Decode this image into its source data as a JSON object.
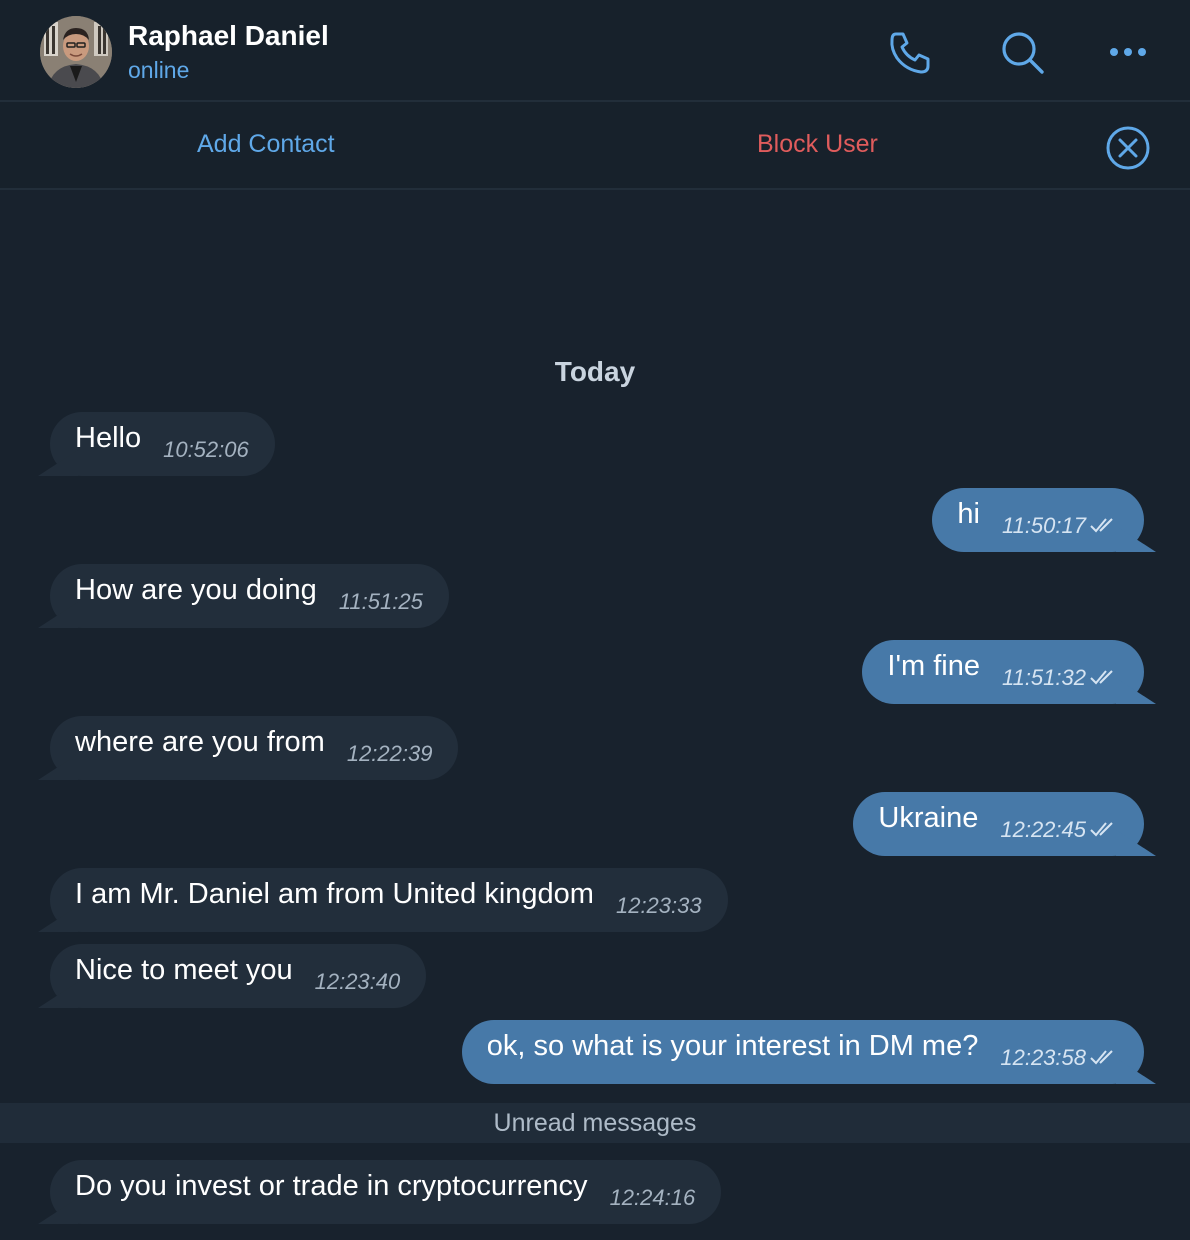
{
  "header": {
    "name": "Raphael Daniel",
    "status": "online",
    "icons": [
      "phone-icon",
      "search-icon",
      "more-icon"
    ]
  },
  "actions": {
    "add_contact": "Add Contact",
    "block_user": "Block User"
  },
  "date_label": "Today",
  "unread_label": "Unread messages",
  "colors": {
    "background": "#18222d",
    "incoming_bubble": "#222e3b",
    "outgoing_bubble": "#4779a8",
    "accent": "#5fa8e8",
    "danger": "#e05c5c"
  },
  "messages": [
    {
      "dir": "in",
      "text": "Hello",
      "time": "10:52:06"
    },
    {
      "dir": "out",
      "text": "hi",
      "time": "11:50:17"
    },
    {
      "dir": "in",
      "text": "How are you doing",
      "time": "11:51:25"
    },
    {
      "dir": "out",
      "text": "I'm fine",
      "time": "11:51:32"
    },
    {
      "dir": "in",
      "text": "where are you from",
      "time": "12:22:39"
    },
    {
      "dir": "out",
      "text": "Ukraine",
      "time": "12:22:45"
    },
    {
      "dir": "in",
      "text": "I am Mr. Daniel am from United kingdom",
      "time": "12:23:33"
    },
    {
      "dir": "in",
      "text": "Nice to meet you",
      "time": "12:23:40"
    },
    {
      "dir": "out",
      "text": "ok, so what is your interest in DM me?",
      "time": "12:23:58"
    },
    {
      "dir": "in",
      "text": "Do you invest or trade in cryptocurrency",
      "time": "12:24:16"
    }
  ]
}
